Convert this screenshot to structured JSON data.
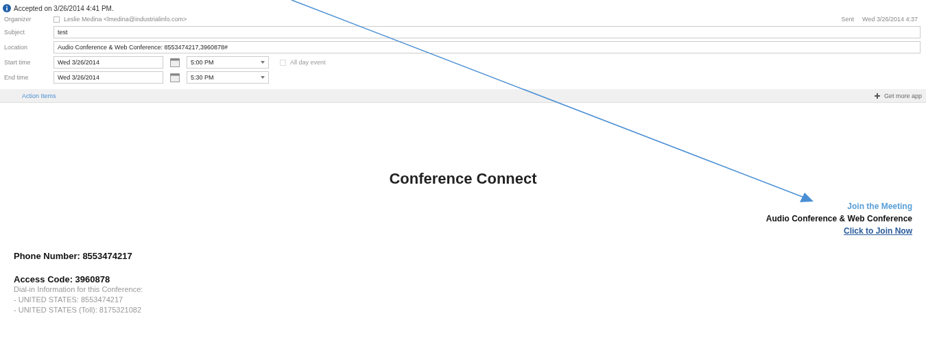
{
  "info_bar": {
    "text": "Accepted on 3/26/2014 4:41 PM."
  },
  "header": {
    "organizer": {
      "label": "Organizer",
      "checked": false,
      "value": "Leslie Medina <lmedina@industrialinfo.com>"
    },
    "sent": {
      "label": "Sent",
      "value": "Wed 3/26/2014 4:37"
    },
    "subject": {
      "label": "Subject",
      "value": "test"
    },
    "location": {
      "label": "Location",
      "value": "Audio Conference & Web Conference: 8553474217,3960878#"
    },
    "start": {
      "label": "Start time",
      "date": "Wed 3/26/2014",
      "time": "5:00 PM",
      "all_day": {
        "label": "All day event",
        "checked": false
      }
    },
    "end": {
      "label": "End time",
      "date": "Wed 3/26/2014",
      "time": "5:30 PM"
    }
  },
  "action_bar": {
    "left": "Action Items",
    "right": "Get more app"
  },
  "body": {
    "title": "Conference Connect",
    "join": {
      "heading": "Join the Meeting",
      "subtitle": "Audio Conference & Web Conference",
      "link": "Click to Join Now"
    },
    "phone": "Phone Number: 8553474217",
    "access": "Access Code: 3960878",
    "dial_lines": [
      "Dial-in Information for this Conference:",
      "- UNITED STATES: 8553474217",
      "- UNITED STATES (Toll): 8175321082"
    ]
  }
}
